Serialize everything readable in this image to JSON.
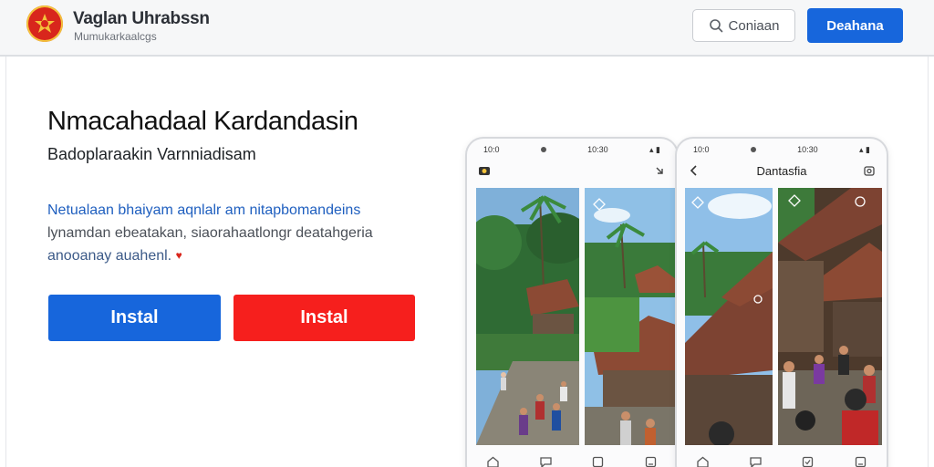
{
  "header": {
    "brand_title": "Vaglan Uhrabssn",
    "brand_subtitle": "Mumukarkaalcgs",
    "search_label": "Coniaan",
    "primary_label": "Deahana"
  },
  "hero": {
    "title": "Nmacahadaal Kardandasin",
    "subtitle": "Badoplaraakin Varnniadisam",
    "desc_line1": "Netualaan bhaiyam aqnlalr am nitapbomandeins",
    "desc_line2": "lynamdan ebeatakan, siaorahaatlongr deatahgeria",
    "desc_line3": "anooanay auahenl.",
    "install_blue": "Instal",
    "install_red": "Instal"
  },
  "phone1": {
    "time_left": "10:0",
    "time_right": "10:30"
  },
  "phone2": {
    "time_left": "10:0",
    "time_right": "10:30",
    "title": "Dantasfia"
  },
  "colors": {
    "primary_blue": "#1766dc",
    "install_red": "#f61f1d",
    "logo_red": "#d8261c"
  },
  "icons": [
    "logo-emblem-icon",
    "search-icon",
    "back-chevron-icon",
    "share-icon",
    "home-icon",
    "chat-icon",
    "grid-icon",
    "profile-icon",
    "heart-icon"
  ]
}
